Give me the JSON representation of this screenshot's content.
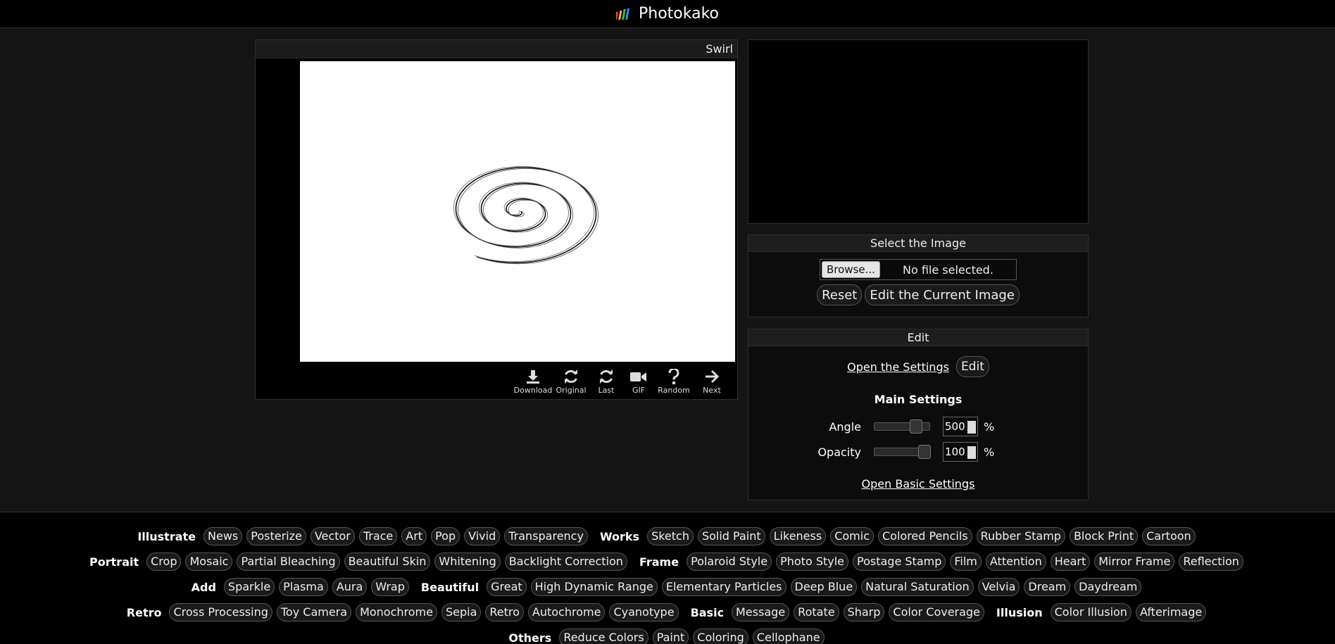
{
  "header": {
    "title": "Photokako",
    "logo_colors": [
      "#e84a3c",
      "#f4b400",
      "#4caf50",
      "#2196f3"
    ]
  },
  "preview": {
    "title": "Swirl",
    "toolbar": [
      {
        "name": "download-button",
        "icon": "download-icon",
        "label": "Download"
      },
      {
        "name": "original-button",
        "icon": "refresh-icon",
        "label": "Original"
      },
      {
        "name": "last-button",
        "icon": "refresh-icon",
        "label": "Last"
      },
      {
        "name": "gif-button",
        "icon": "video-camera-icon",
        "label": "GIF"
      },
      {
        "name": "random-button",
        "icon": "question-icon",
        "label": "Random"
      },
      {
        "name": "next-button",
        "icon": "arrow-right-icon",
        "label": "Next"
      }
    ]
  },
  "select": {
    "title": "Select the Image",
    "browse_label": "Browse...",
    "file_status": "No file selected.",
    "reset_label": "Reset",
    "edit_current_label": "Edit the Current Image"
  },
  "edit": {
    "title": "Edit",
    "open_settings_label": "Open the Settings",
    "edit_label": "Edit",
    "main_settings_label": "Main Settings",
    "sliders": [
      {
        "label": "Angle",
        "value": "500",
        "unit": "%",
        "level": 0.8
      },
      {
        "label": "Opacity",
        "value": "100",
        "unit": "%",
        "level": 1.0
      }
    ],
    "basic_settings_label": "Open Basic Settings"
  },
  "footer": {
    "rows": [
      [
        {
          "category": "Illustrate",
          "tags": [
            "News",
            "Posterize",
            "Vector",
            "Trace",
            "Art",
            "Pop",
            "Vivid",
            "Transparency"
          ]
        },
        {
          "category": "Works",
          "tags": [
            "Sketch",
            "Solid Paint",
            "Likeness",
            "Comic",
            "Colored Pencils",
            "Rubber Stamp",
            "Block Print",
            "Cartoon"
          ]
        }
      ],
      [
        {
          "category": "Portrait",
          "tags": [
            "Crop",
            "Mosaic",
            "Partial Bleaching",
            "Beautiful Skin",
            "Whitening",
            "Backlight Correction"
          ]
        },
        {
          "category": "Frame",
          "tags": [
            "Polaroid Style",
            "Photo Style",
            "Postage Stamp",
            "Film",
            "Attention",
            "Heart",
            "Mirror Frame",
            "Reflection"
          ]
        }
      ],
      [
        {
          "category": "Add",
          "tags": [
            "Sparkle",
            "Plasma",
            "Aura",
            "Wrap"
          ]
        },
        {
          "category": "Beautiful",
          "tags": [
            "Great",
            "High Dynamic Range",
            "Elementary Particles",
            "Deep Blue",
            "Natural Saturation",
            "Velvia",
            "Dream",
            "Daydream"
          ]
        }
      ],
      [
        {
          "category": "Retro",
          "tags": [
            "Cross Processing",
            "Toy Camera",
            "Monochrome",
            "Sepia",
            "Retro",
            "Autochrome",
            "Cyanotype"
          ]
        },
        {
          "category": "Basic",
          "tags": [
            "Message",
            "Rotate",
            "Sharp",
            "Color Coverage"
          ]
        },
        {
          "category": "Illusion",
          "tags": [
            "Color Illusion",
            "Afterimage"
          ]
        }
      ],
      [
        {
          "category": "Others",
          "tags": [
            "Reduce Colors",
            "Paint",
            "Coloring",
            "Cellophane"
          ]
        }
      ]
    ]
  }
}
